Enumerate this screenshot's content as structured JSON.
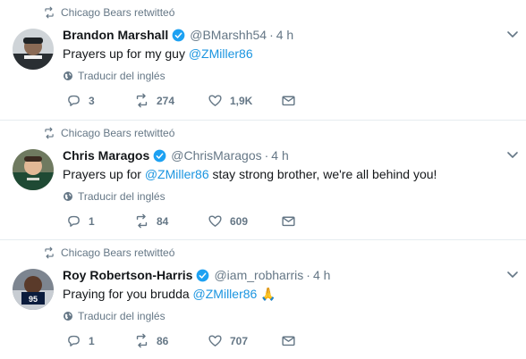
{
  "tweets": [
    {
      "retweeted_by": "Chicago Bears retwitteó",
      "name": "Brandon Marshall",
      "handle": "@BMarshh54",
      "separator": "·",
      "time": "4 h",
      "text_before": "Prayers up for my guy ",
      "mention": "@ZMiller86",
      "text_after": "",
      "translate": "Traducir del inglés",
      "replies": "3",
      "retweets": "274",
      "likes": "1,9K"
    },
    {
      "retweeted_by": "Chicago Bears retwitteó",
      "name": "Chris Maragos",
      "handle": "@ChrisMaragos",
      "separator": "·",
      "time": "4 h",
      "text_before": "Prayers up for ",
      "mention": "@ZMiller86",
      "text_after": " stay strong brother, we're all behind you!",
      "translate": "Traducir del inglés",
      "replies": "1",
      "retweets": "84",
      "likes": "609"
    },
    {
      "retweeted_by": "Chicago Bears retwitteó",
      "name": "Roy Robertson-Harris",
      "handle": "@iam_robharris",
      "separator": "·",
      "time": "4 h",
      "text_before": "Praying for you brudda ",
      "mention": "@ZMiller86",
      "text_after": " 🙏",
      "translate": "Traducir del inglés",
      "replies": "1",
      "retweets": "86",
      "likes": "707"
    }
  ],
  "colors": {
    "link": "#1b95e0",
    "secondary": "#657786",
    "verified": "#1da1f2",
    "divider": "#e6ecf0"
  },
  "icons": {
    "retweet": "retweet-icon",
    "verified": "verified-badge-icon",
    "globe": "globe-icon",
    "reply": "reply-icon",
    "like": "heart-icon",
    "dm": "envelope-icon",
    "caret": "chevron-down-icon"
  }
}
